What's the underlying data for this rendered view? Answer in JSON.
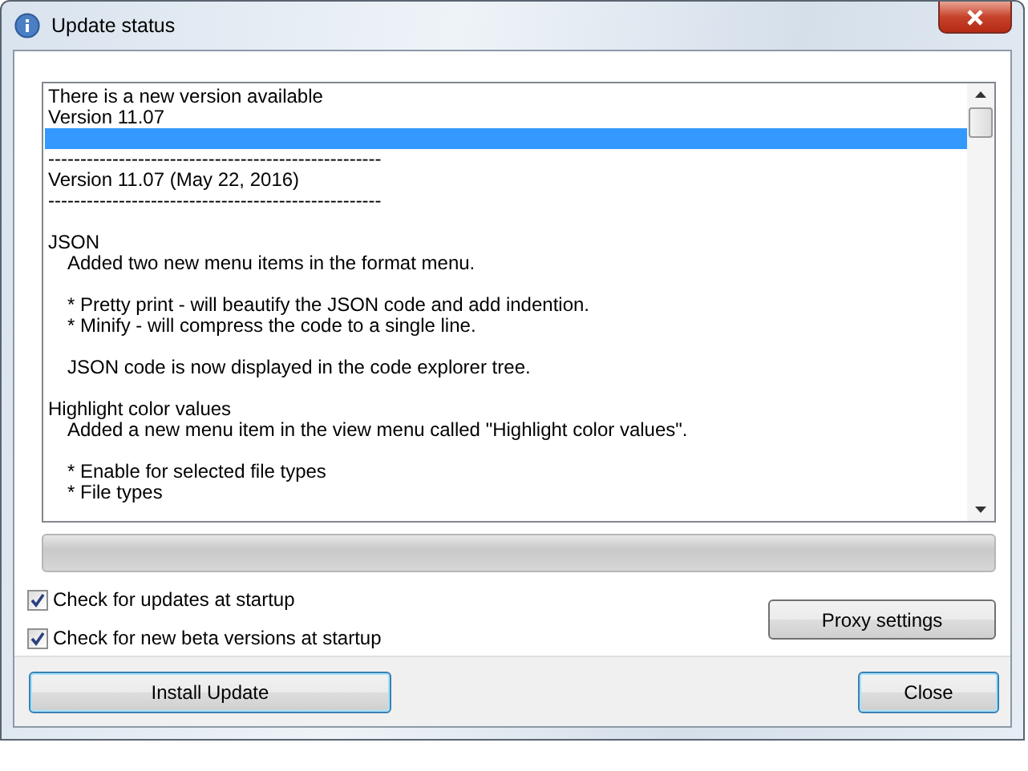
{
  "window": {
    "title": "Update status"
  },
  "log": {
    "lines": [
      {
        "kind": "text",
        "text": "There is a new version available",
        "selected": false
      },
      {
        "kind": "text",
        "text": "Version 11.07",
        "selected": false
      },
      {
        "kind": "blank",
        "selected": true
      },
      {
        "kind": "text",
        "text": "----------------------------------------------------",
        "selected": false
      },
      {
        "kind": "text",
        "text": "Version 11.07 (May 22, 2016)",
        "selected": false
      },
      {
        "kind": "text",
        "text": "----------------------------------------------------",
        "selected": false
      },
      {
        "kind": "blank",
        "selected": false
      },
      {
        "kind": "text",
        "text": "JSON",
        "selected": false
      },
      {
        "kind": "indented",
        "text": "Added two new menu items in the format menu.",
        "selected": false
      },
      {
        "kind": "blank",
        "selected": false
      },
      {
        "kind": "indented",
        "text": "* Pretty print - will beautify the JSON code and add indention.",
        "selected": false
      },
      {
        "kind": "indented",
        "text": "* Minify - will compress the code to a single line.",
        "selected": false
      },
      {
        "kind": "blank",
        "selected": false
      },
      {
        "kind": "indented",
        "text": "JSON code is now displayed in the code explorer tree.",
        "selected": false
      },
      {
        "kind": "blank",
        "selected": false
      },
      {
        "kind": "text",
        "text": "Highlight color values",
        "selected": false
      },
      {
        "kind": "indented",
        "text": "Added a new menu item in the view menu called \"Highlight color values\".",
        "selected": false
      },
      {
        "kind": "blank",
        "selected": false
      },
      {
        "kind": "indented",
        "text": "* Enable for selected file types",
        "selected": false
      },
      {
        "kind": "indented",
        "text": "* File types",
        "selected": false
      }
    ]
  },
  "progress": {
    "level": 0
  },
  "options": [
    {
      "label": "Check for updates at startup",
      "checked": true
    },
    {
      "label": "Check for new beta versions at startup",
      "checked": true
    }
  ],
  "proxy_button": "Proxy settings",
  "buttons": [
    {
      "label": "Install Update",
      "focused": true
    },
    {
      "label": "Close",
      "focused": true
    }
  ]
}
